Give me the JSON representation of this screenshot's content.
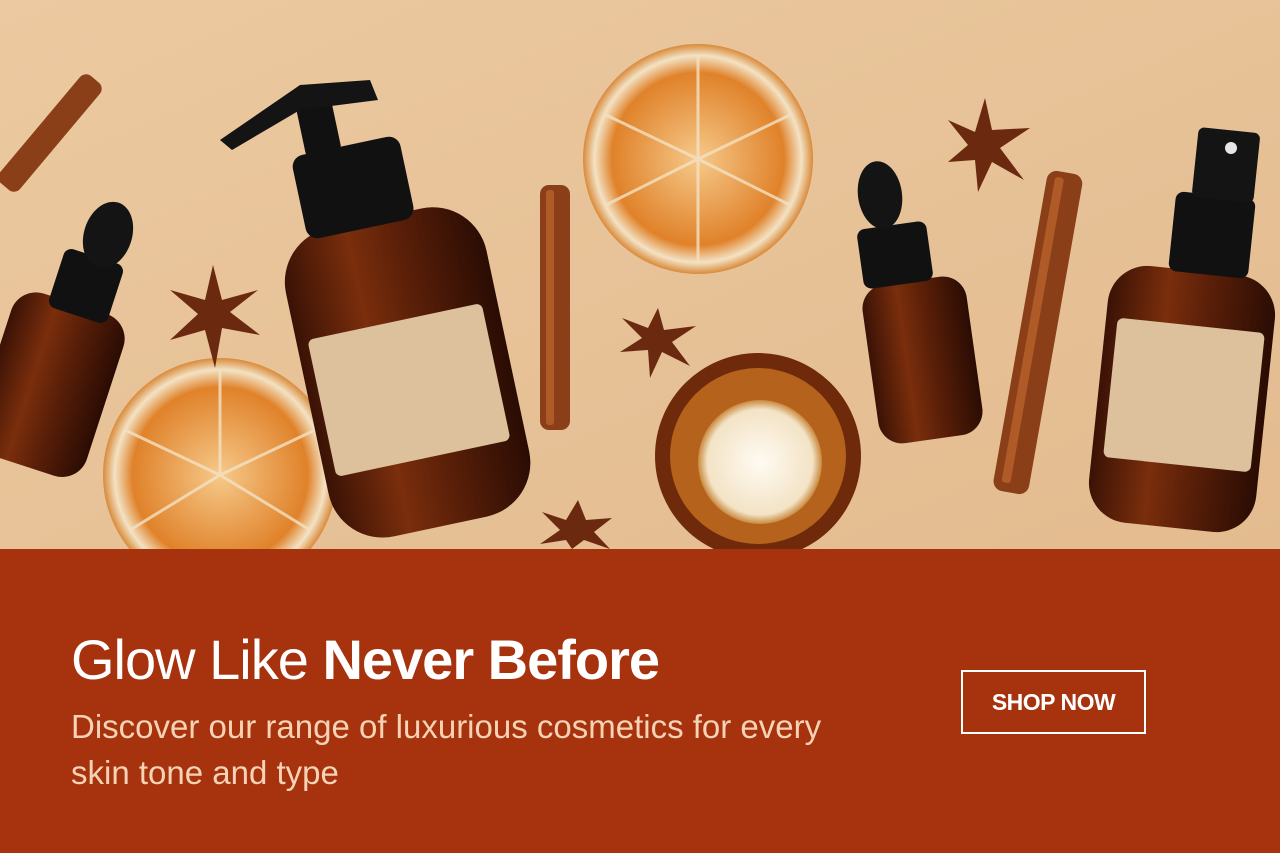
{
  "hero": {
    "image_subject": "amber cosmetic bottles with dried oranges, cinnamon sticks and star anise",
    "background_color": "#e8c49b"
  },
  "banner": {
    "headline_light": "Glow Like",
    "headline_bold": "Never Before",
    "subtext": "Discover our range of luxurious cosmetics for every skin tone and type",
    "cta_label": "SHOP NOW"
  },
  "colors": {
    "panel": "#a6330e",
    "headline": "#ffffff",
    "subtext": "#f6d3b6",
    "cta_border": "#ffffff"
  }
}
